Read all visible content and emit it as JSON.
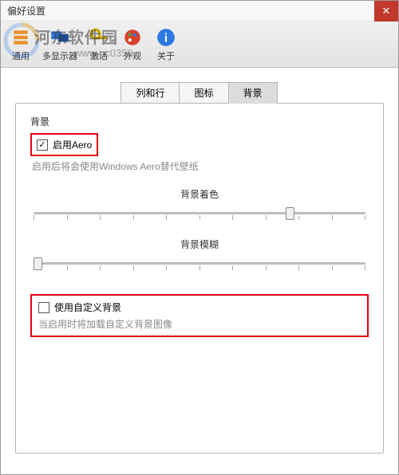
{
  "window": {
    "title": "偏好设置"
  },
  "watermark": {
    "text": "河东软件园",
    "url": "www.pc0359."
  },
  "toolbar": {
    "items": [
      {
        "label": "通用"
      },
      {
        "label": "多显示器"
      },
      {
        "label": "激活"
      },
      {
        "label": "外观"
      },
      {
        "label": "关于"
      }
    ]
  },
  "tabs": {
    "items": [
      {
        "label": "列和行"
      },
      {
        "label": "图标"
      },
      {
        "label": "背景"
      }
    ],
    "active_index": 2
  },
  "panel": {
    "group_title": "背景",
    "enable_aero": {
      "label": "启用Aero",
      "checked": true
    },
    "enable_aero_desc": "启用后将会使用Windows Aero替代壁纸",
    "slider_tint": {
      "label": "背景着色",
      "value": 0.78
    },
    "slider_blur": {
      "label": "背景模糊",
      "value": 0.0
    },
    "custom_bg": {
      "label": "使用自定义背景",
      "checked": false
    },
    "custom_bg_desc": "当启用时将加载自定义背景图像"
  },
  "colors": {
    "accent_red": "#e60012",
    "close_red": "#c0392b"
  }
}
